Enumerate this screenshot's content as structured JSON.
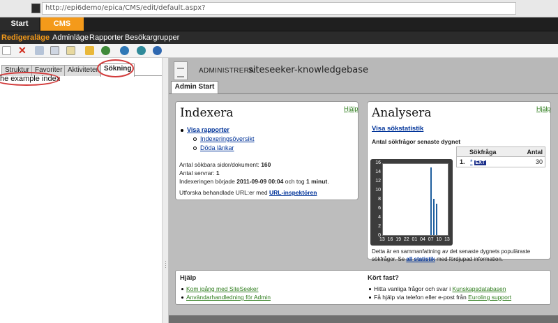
{
  "browser": {
    "url": "http://epi6demo/epica/CMS/edit/default.aspx?"
  },
  "topbar": {
    "tabs": [
      "Start",
      "CMS"
    ]
  },
  "submenu": {
    "items": [
      "Redigeraläge",
      "Adminläge",
      "Rapporter",
      "Besökargrupper"
    ]
  },
  "toolbar": {
    "icons": [
      "new-page-icon",
      "delete-icon",
      "cut-icon",
      "copy-icon",
      "paste-icon",
      "key-icon",
      "users-icon",
      "globe-icon",
      "globe-refresh-icon",
      "globe-alt-icon"
    ]
  },
  "leftpane": {
    "tabs": [
      "Struktur",
      "Favoriter",
      "Aktiviteter",
      "Sökning"
    ],
    "active_tab": "Sökning",
    "result": "he example index"
  },
  "header": {
    "label": "ADMINISTRERA:",
    "title": "siteseeker-knowledgebase",
    "tab": "Admin Start"
  },
  "index_panel": {
    "title": "Indexera",
    "help": "Hjälp",
    "report_link": "Visa rapporter",
    "sublinks": [
      "Indexeringsöversikt",
      "Döda länkar"
    ],
    "stats": {
      "docs_label": "Antal sökbara sidor/dokument:",
      "docs_value": "160",
      "servers_label": "Antal servrar:",
      "servers_value": "1",
      "indexing_label": "Indexeringen började",
      "indexing_date": "2011-09-09 00:04",
      "indexing_mid": "och tog",
      "indexing_duration": "1 minut",
      "indexing_end": "."
    },
    "explore_text": "Utforska behandlade URL:er med",
    "explore_link": "URL-inspektören"
  },
  "analysis_panel": {
    "title": "Analysera",
    "help": "Hjälp",
    "stats_link": "Visa sökstatistik",
    "chart_title": "Antal sökfrågor senaste dygnet",
    "table_headers": [
      "Sökfråga",
      "Antal"
    ],
    "table_rows": [
      {
        "rank": "1.",
        "query": "*",
        "badge": "EXT",
        "count": "30"
      }
    ],
    "summary_1": "Detta är en sammanfattning av det senaste dygnets populäraste",
    "summary_2a": "sökfrågor. Se",
    "summary_link": "all statistik",
    "summary_2b": "med fördjupad information."
  },
  "help_panel": {
    "title": "Hjälp",
    "links": [
      "Kom igång med SiteSeeker",
      "Användarhandledning för Admin"
    ]
  },
  "stuck_panel": {
    "title": "Kört fast?",
    "line1_text": "Hitta vanliga frågor och svar i",
    "line1_link": "Kunskapsdatabasen",
    "line2_text": "Få hjälp via telefon eller e-post från",
    "line2_link": "Euroling support"
  },
  "chart_data": {
    "type": "bar",
    "title": "Antal sökfrågor senaste dygnet",
    "x_ticks": [
      "13",
      "16",
      "19",
      "22",
      "01",
      "04",
      "07",
      "10",
      "13"
    ],
    "y_ticks": [
      "16",
      "14",
      "12",
      "10",
      "8",
      "6",
      "4",
      "2",
      "0"
    ],
    "ylim": [
      0,
      16
    ],
    "bars": [
      {
        "hour": "07",
        "value": 15
      },
      {
        "hour": "08",
        "value": 8
      },
      {
        "hour": "09",
        "value": 7
      }
    ],
    "colors": {
      "bar": "#1f5f9e",
      "frame": "#3c3c3c"
    }
  }
}
